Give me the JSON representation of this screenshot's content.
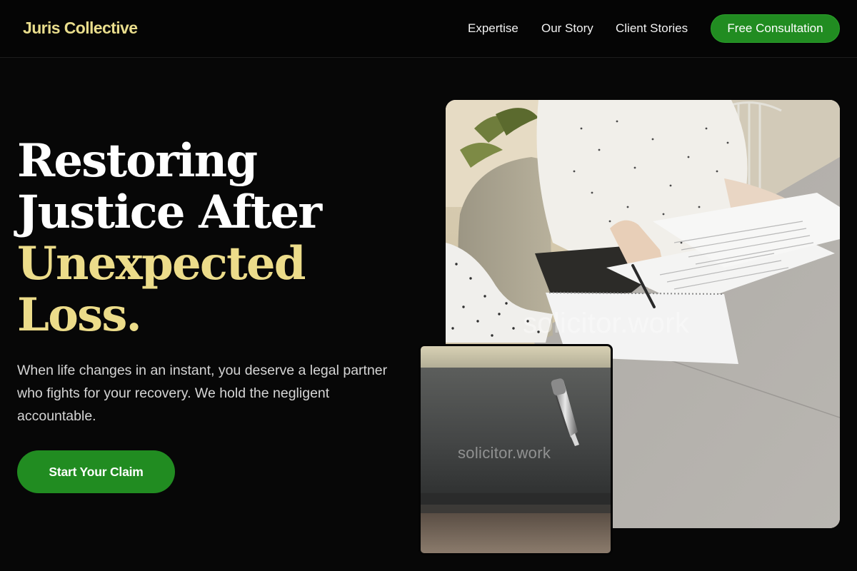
{
  "header": {
    "brand": "Juris Collective",
    "nav": [
      {
        "label": "Expertise"
      },
      {
        "label": "Our Story"
      },
      {
        "label": "Client Stories"
      }
    ],
    "cta_label": "Free Consultation"
  },
  "hero": {
    "headline_lines": [
      {
        "text": "Restoring",
        "color": "white"
      },
      {
        "text": "Justice After",
        "color": "white"
      },
      {
        "text": "Unexpected",
        "color": "gold"
      },
      {
        "text": "Loss.",
        "color": "gold"
      }
    ],
    "lede": "When life changes in an instant, you deserve a legal partner who fights for your recovery. We hold the negligent accountable.",
    "cta_label": "Start Your Claim"
  },
  "images": {
    "main_watermark": "solicitor.work",
    "inset_watermark": "solicitor.work"
  },
  "colors": {
    "background": "#070707",
    "accent_gold": "#ecdc8a",
    "brand_gold": "#e9dd8c",
    "button_green": "#218c21",
    "body_text": "#d5d5d5"
  }
}
